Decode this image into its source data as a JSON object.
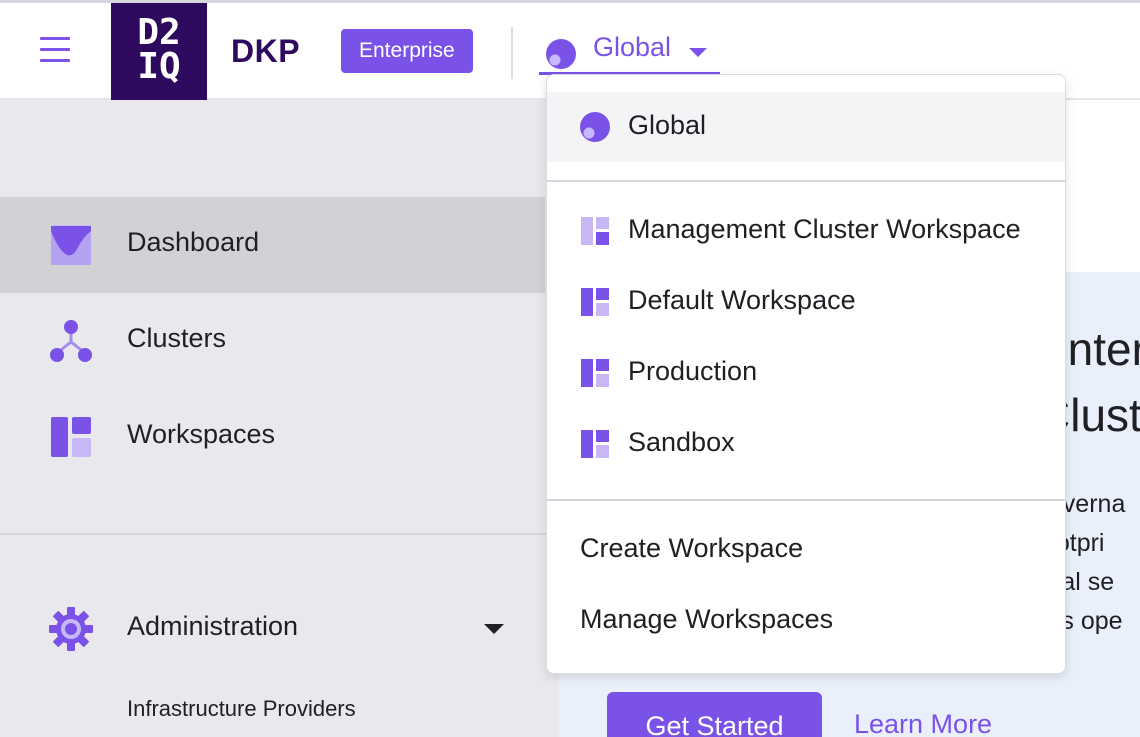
{
  "header": {
    "logo_text": "D2IQ",
    "brand": "DKP",
    "edition_badge": "Enterprise",
    "workspace_selector": {
      "selected": "Global"
    }
  },
  "sidebar": {
    "items": [
      {
        "label": "Dashboard",
        "icon": "dashboard-icon",
        "active": true
      },
      {
        "label": "Clusters",
        "icon": "clusters-icon",
        "active": false
      },
      {
        "label": "Workspaces",
        "icon": "workspaces-icon",
        "active": false
      }
    ],
    "administration": {
      "label": "Administration",
      "icon": "gear-icon",
      "expanded": true
    },
    "sub_items": [
      {
        "label": "Infrastructure Providers"
      }
    ]
  },
  "main": {
    "promo": {
      "heading_line1": "Enterpr",
      "heading_line2": "Clust",
      "body_lines": [
        "governa",
        "footpri",
        "ntial se",
        "ces ope"
      ],
      "primary_button": "Get Started",
      "secondary_link": "Learn More"
    }
  },
  "dropdown": {
    "global_item": {
      "label": "Global",
      "icon": "globe-icon",
      "selected": true
    },
    "workspaces": [
      {
        "label": "Management Cluster Workspace",
        "icon": "workspace-icon"
      },
      {
        "label": "Default Workspace",
        "icon": "workspace-icon"
      },
      {
        "label": "Production",
        "icon": "workspace-icon"
      },
      {
        "label": "Sandbox",
        "icon": "workspace-icon"
      }
    ],
    "actions": [
      {
        "label": "Create Workspace"
      },
      {
        "label": "Manage Workspaces"
      }
    ]
  },
  "colors": {
    "accent": "#7b52e8",
    "brand_dark": "#2e0a5e",
    "sidebar_bg": "#e9e8ed",
    "sidebar_active": "#d1d1d6",
    "promo_bg": "#eaf0fb"
  }
}
